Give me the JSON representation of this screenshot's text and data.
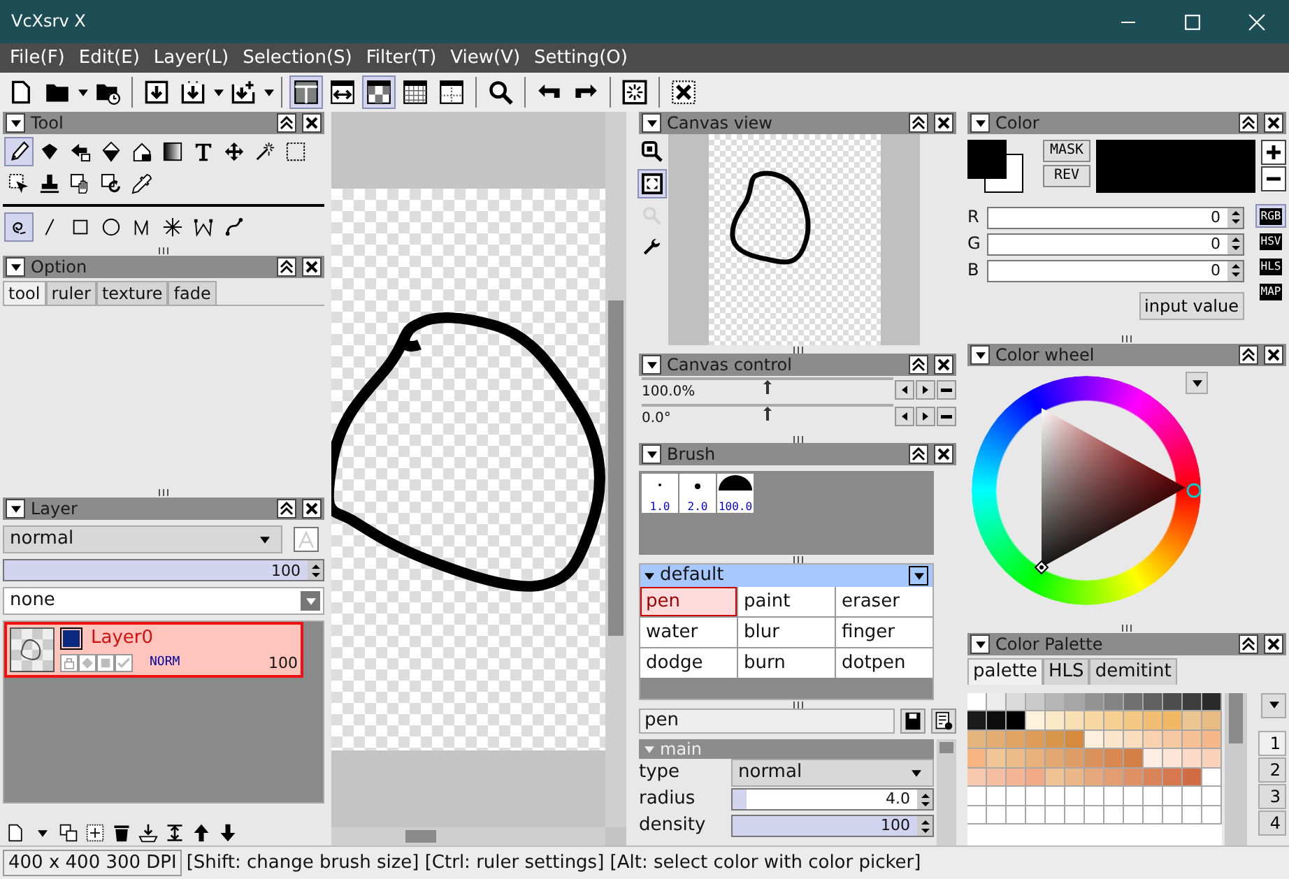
{
  "window": {
    "title": "VcXsrv X"
  },
  "menu": [
    "File(F)",
    "Edit(E)",
    "Layer(L)",
    "Selection(S)",
    "Filter(T)",
    "View(V)",
    "Setting(O)"
  ],
  "toolbar": [
    {
      "kind": "button",
      "selected": false
    },
    {
      "kind": "button",
      "selected": false
    },
    {
      "kind": "dropdown"
    },
    {
      "kind": "button",
      "selected": false
    },
    {
      "kind": "separator"
    },
    {
      "kind": "button",
      "selected": false
    },
    {
      "kind": "button",
      "selected": false
    },
    {
      "kind": "dropdown"
    },
    {
      "kind": "button",
      "selected": false
    },
    {
      "kind": "dropdown"
    },
    {
      "kind": "separator"
    },
    {
      "kind": "button",
      "selected": true
    },
    {
      "kind": "button",
      "selected": false
    },
    {
      "kind": "button",
      "selected": true
    },
    {
      "kind": "button",
      "selected": false
    },
    {
      "kind": "button",
      "selected": false
    },
    {
      "kind": "separator"
    },
    {
      "kind": "button",
      "selected": false
    },
    {
      "kind": "separator"
    },
    {
      "kind": "button",
      "selected": false
    },
    {
      "kind": "button",
      "selected": false
    },
    {
      "kind": "separator"
    },
    {
      "kind": "button",
      "selected": false
    },
    {
      "kind": "separator"
    },
    {
      "kind": "button",
      "selected": false
    }
  ],
  "tool_panel": {
    "title": "Tool",
    "tools": [
      {
        "selected": true
      },
      {
        "selected": false
      },
      {
        "selected": false
      },
      {
        "selected": false
      },
      {
        "selected": false
      },
      {
        "selected": false
      },
      {
        "selected": false
      },
      {
        "selected": false
      },
      {
        "selected": false
      },
      {
        "selected": false
      },
      {
        "selected": false
      },
      {
        "selected": false
      },
      {
        "selected": false
      },
      {
        "selected": false
      },
      {
        "selected": false
      }
    ],
    "shape_tools": [
      {
        "selected": true
      },
      {
        "selected": false
      },
      {
        "selected": false
      },
      {
        "selected": false
      },
      {
        "selected": false
      },
      {
        "selected": false
      },
      {
        "selected": false
      },
      {
        "selected": false
      }
    ]
  },
  "option_panel": {
    "title": "Option",
    "tabs": [
      {
        "label": "tool",
        "selected": true
      },
      {
        "label": "ruler",
        "selected": false
      },
      {
        "label": "texture",
        "selected": false
      },
      {
        "label": "fade",
        "selected": false
      }
    ]
  },
  "layer_panel": {
    "title": "Layer",
    "blend_mode": "normal",
    "opacity": {
      "value": "100",
      "level": 1
    },
    "mask": "none",
    "layers": [
      {
        "name": "Layer0",
        "selected": true,
        "color": "#0a2a80",
        "mode": "NORM",
        "opacity": "100"
      }
    ]
  },
  "canvas_view": {
    "title": "Canvas view",
    "tools": [
      {
        "selected": false,
        "disabled": false
      },
      {
        "selected": true,
        "disabled": false
      },
      {
        "selected": false,
        "disabled": true
      },
      {
        "selected": false,
        "disabled": false
      }
    ]
  },
  "canvas_control": {
    "title": "Canvas control",
    "rows": [
      {
        "value": "100.0%",
        "level": 0.5
      },
      {
        "value": "0.0°",
        "level": 0.5
      }
    ]
  },
  "brush_panel": {
    "title": "Brush",
    "sizes": [
      {
        "label": "1.0"
      },
      {
        "label": "2.0"
      },
      {
        "label": "100.0"
      }
    ],
    "group": "default",
    "brushes": [
      {
        "label": "pen",
        "selected": true
      },
      {
        "label": "paint",
        "selected": false
      },
      {
        "label": "eraser",
        "selected": false
      },
      {
        "label": "water",
        "selected": false
      },
      {
        "label": "blur",
        "selected": false
      },
      {
        "label": "finger",
        "selected": false
      },
      {
        "label": "dodge",
        "selected": false
      },
      {
        "label": "burn",
        "selected": false
      },
      {
        "label": "dotpen",
        "selected": false
      }
    ],
    "name": "pen",
    "section": "main",
    "settings": [
      {
        "label": "type",
        "kind": "select",
        "value": "normal"
      },
      {
        "label": "radius",
        "kind": "number",
        "value": "4.0",
        "level": 0.07
      },
      {
        "label": "density",
        "kind": "number",
        "value": "100",
        "level": 1
      }
    ]
  },
  "color_panel": {
    "title": "Color",
    "swatches": [
      {
        "kind": "foreground",
        "color": "#000000"
      },
      {
        "kind": "background",
        "color": "#ffffff"
      }
    ],
    "mask_button": "MASK",
    "rev_button": "REV",
    "current": {
      "color": "#000000"
    },
    "channels": [
      {
        "label": "R",
        "value": "0",
        "level": 0
      },
      {
        "label": "G",
        "value": "0",
        "level": 0
      },
      {
        "label": "B",
        "value": "0",
        "level": 0
      }
    ],
    "input_button": "input value",
    "modes": [
      {
        "label": "RGB",
        "selected": true
      },
      {
        "label": "HSV",
        "selected": false
      },
      {
        "label": "HLS",
        "selected": false
      },
      {
        "label": "MAP",
        "selected": false
      }
    ]
  },
  "color_wheel": {
    "title": "Color wheel"
  },
  "color_palette": {
    "title": "Color Palette",
    "tabs": [
      {
        "label": "palette",
        "selected": true
      },
      {
        "label": "HLS",
        "selected": false
      },
      {
        "label": "demitint",
        "selected": false
      }
    ],
    "swatch_rows": [
      {
        "swatches": [
          {
            "color": "#ffffff"
          },
          {
            "color": "#ececec"
          },
          {
            "color": "#dadada"
          },
          {
            "color": "#c9c9c9"
          },
          {
            "color": "#b7b7b7"
          },
          {
            "color": "#a6a6a6"
          },
          {
            "color": "#949494"
          },
          {
            "color": "#838383"
          },
          {
            "color": "#717171"
          },
          {
            "color": "#606060"
          },
          {
            "color": "#4e4e4e"
          },
          {
            "color": "#3d3d3d"
          },
          {
            "color": "#2b2b2b"
          }
        ]
      },
      {
        "swatches": [
          {
            "color": "#1a1a1a"
          },
          {
            "color": "#0d0d0d"
          },
          {
            "color": "#000000"
          },
          {
            "color": "#fdf2dc"
          },
          {
            "color": "#fbe8c6"
          },
          {
            "color": "#f9e0b4"
          },
          {
            "color": "#f7d8a2"
          },
          {
            "color": "#f6cf92"
          },
          {
            "color": "#f4c783"
          },
          {
            "color": "#f2be74"
          },
          {
            "color": "#f1b765"
          },
          {
            "color": "#ebc592"
          },
          {
            "color": "#e8bb83"
          }
        ]
      },
      {
        "swatches": [
          {
            "color": "#e6b67f"
          },
          {
            "color": "#e4ad71"
          },
          {
            "color": "#e2a563"
          },
          {
            "color": "#de9d58"
          },
          {
            "color": "#da954c"
          },
          {
            "color": "#d68a3e"
          },
          {
            "color": "#fcf0dc"
          },
          {
            "color": "#fbe6cd"
          },
          {
            "color": "#fadcbe"
          },
          {
            "color": "#f9d3b0"
          },
          {
            "color": "#f8caa3"
          },
          {
            "color": "#f7c197"
          },
          {
            "color": "#f6b88b"
          }
        ]
      },
      {
        "swatches": [
          {
            "color": "#f5b481"
          },
          {
            "color": "#f0c695"
          },
          {
            "color": "#ecbc88"
          },
          {
            "color": "#e8b27c"
          },
          {
            "color": "#e3a770"
          },
          {
            "color": "#df9d65"
          },
          {
            "color": "#db935a"
          },
          {
            "color": "#d7894f"
          },
          {
            "color": "#d37f44"
          },
          {
            "color": "#fdeee4"
          },
          {
            "color": "#fce4d6"
          },
          {
            "color": "#fbdac8"
          },
          {
            "color": "#fad1bb"
          }
        ]
      },
      {
        "swatches": [
          {
            "color": "#f8c9ae"
          },
          {
            "color": "#f7bfa1"
          },
          {
            "color": "#f5b594"
          },
          {
            "color": "#f3aa87"
          },
          {
            "color": "#efc394"
          },
          {
            "color": "#ebb688"
          },
          {
            "color": "#e7a97c"
          },
          {
            "color": "#e39d70"
          },
          {
            "color": "#df9065"
          },
          {
            "color": "#db845a"
          },
          {
            "color": "#d7784f"
          },
          {
            "color": "#d36c44"
          },
          {
            "color": "#ffffff"
          }
        ]
      },
      {
        "swatches": [
          {
            "color": "#ffffff"
          },
          {
            "color": "#ffffff"
          },
          {
            "color": "#ffffff"
          },
          {
            "color": "#ffffff"
          },
          {
            "color": "#ffffff"
          },
          {
            "color": "#ffffff"
          },
          {
            "color": "#ffffff"
          },
          {
            "color": "#ffffff"
          },
          {
            "color": "#ffffff"
          },
          {
            "color": "#ffffff"
          },
          {
            "color": "#ffffff"
          },
          {
            "color": "#ffffff"
          },
          {
            "color": "#ffffff"
          }
        ]
      },
      {
        "swatches": [
          {
            "color": "#ffffff"
          },
          {
            "color": "#ffffff"
          },
          {
            "color": "#ffffff"
          },
          {
            "color": "#ffffff"
          },
          {
            "color": "#ffffff"
          },
          {
            "color": "#ffffff"
          },
          {
            "color": "#ffffff"
          },
          {
            "color": "#ffffff"
          },
          {
            "color": "#ffffff"
          },
          {
            "color": "#ffffff"
          },
          {
            "color": "#ffffff"
          },
          {
            "color": "#ffffff"
          },
          {
            "color": "#ffffff"
          }
        ]
      }
    ],
    "pages": [
      {
        "label": "1",
        "selected": true
      },
      {
        "label": "2",
        "selected": false
      },
      {
        "label": "3",
        "selected": false
      },
      {
        "label": "4",
        "selected": false
      }
    ]
  },
  "status_bar": {
    "canvas_info": "400 x 400 300 DPI",
    "hint": "[Shift: change brush size] [Ctrl: ruler settings] [Alt: select color with color picker]"
  }
}
